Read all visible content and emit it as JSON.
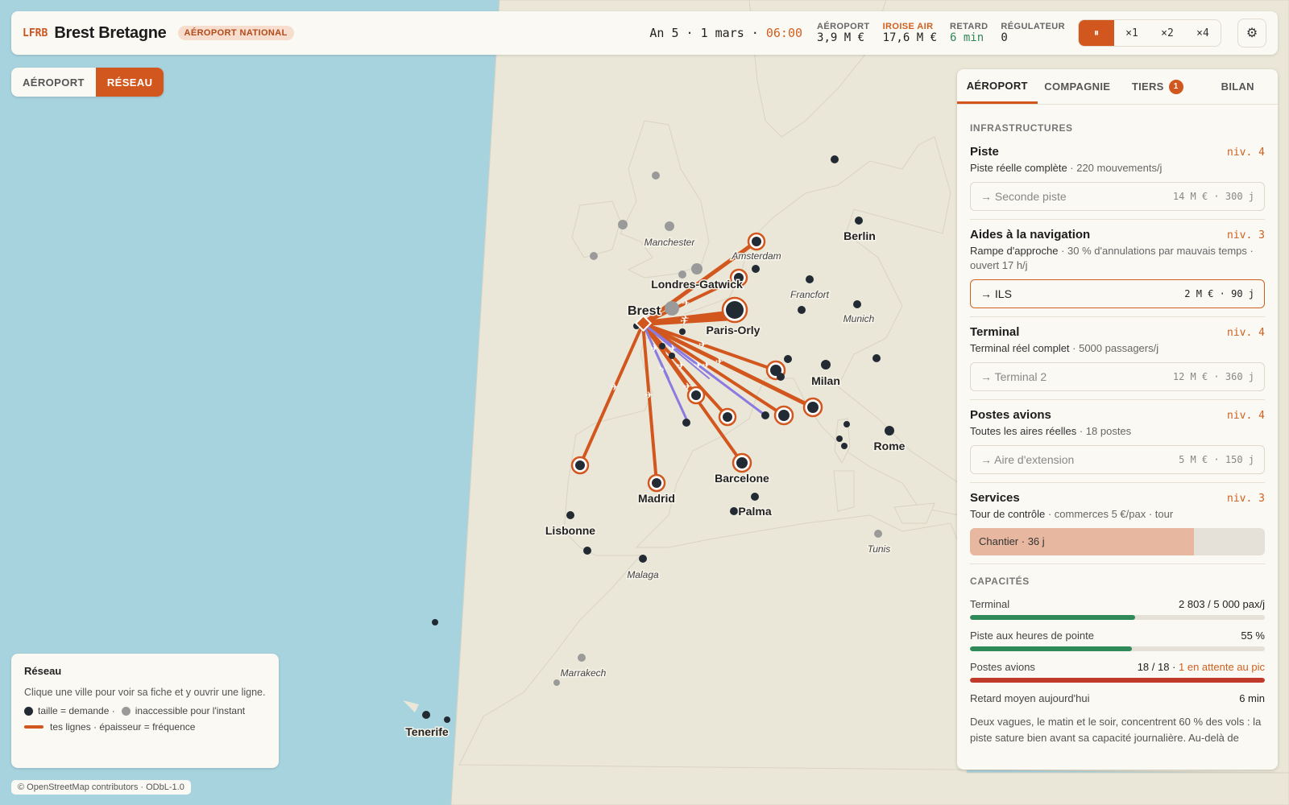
{
  "header": {
    "code": "LFRB",
    "airport_name": "Brest Bretagne",
    "category_badge": "AÉROPORT NATIONAL",
    "date_text": "An 5 · 1 mars · ",
    "time": "06:00",
    "stats": [
      {
        "label": "AÉROPORT",
        "value": "3,9 M €"
      },
      {
        "label": "IROISE AIR",
        "value": "17,6 M €"
      },
      {
        "label": "RETARD",
        "value": "6 min"
      },
      {
        "label": "RÉGULATEUR",
        "value": "0"
      }
    ],
    "speeds": [
      "⏸",
      "×1",
      "×2",
      "×4"
    ],
    "active_speed": 0,
    "settings_icon": "⚙"
  },
  "mode_tabs": {
    "items": [
      "AÉROPORT",
      "RÉSEAU"
    ],
    "active": 1
  },
  "panel": {
    "tabs": [
      {
        "label": "AÉROPORT"
      },
      {
        "label": "COMPAGNIE"
      },
      {
        "label": "TIERS",
        "count": "1"
      },
      {
        "label": "BILAN"
      }
    ],
    "active_tab": 0,
    "infra_title": "INFRASTRUCTURES",
    "items": [
      {
        "name": "Piste",
        "level": "niv. 4",
        "desc": "Piste réelle complète",
        "meta": " · 220 mouvements/j",
        "upgrade": "→ Seconde piste",
        "cost": "14 M € · 300 j",
        "affordable": false
      },
      {
        "name": "Aides à la navigation",
        "level": "niv. 3",
        "desc": "Rampe d'approche",
        "meta": " · 30 % d'annulations par mauvais temps · ouvert 17 h/j",
        "upgrade": "→ ILS",
        "cost": "2 M € · 90 j",
        "affordable": true
      },
      {
        "name": "Terminal",
        "level": "niv. 4",
        "desc": "Terminal réel complet",
        "meta": " · 5000 passagers/j",
        "upgrade": "→ Terminal 2",
        "cost": "12 M € · 360 j",
        "affordable": false
      },
      {
        "name": "Postes avions",
        "level": "niv. 4",
        "desc": "Toutes les aires réelles",
        "meta": " · 18 postes",
        "upgrade": "→ Aire d'extension",
        "cost": "5 M € · 150 j",
        "affordable": false
      }
    ],
    "services": {
      "name": "Services",
      "level": "niv. 3",
      "desc": "Tour de contrôle",
      "meta": " · commerces 5 €/pax · tour",
      "construction": "Chantier · 36 j",
      "construction_progress": 0.76
    },
    "cap_title": "CAPACITÉS",
    "capacities": [
      {
        "label": "Terminal",
        "value": "2 803 / 5 000 pax/j",
        "extra": "",
        "fraction": 0.56,
        "color": "#2f8a5a"
      },
      {
        "label": "Piste aux heures de pointe",
        "value": "55 %",
        "extra": "",
        "fraction": 0.55,
        "color": "#2f8a5a"
      },
      {
        "label": "Postes avions",
        "value": "18 / 18 · ",
        "extra": "1 en attente au pic",
        "fraction": 1.0,
        "color": "#c0392b"
      }
    ],
    "delay_label": "Retard moyen aujourd'hui",
    "delay_value": "6 min",
    "note": "Deux vagues, le matin et le soir, concentrent 60 % des vols : la piste sature bien avant sa capacité journalière. Au-delà de"
  },
  "legend": {
    "title": "Réseau",
    "text": "Clique une ville pour voir sa fiche et y ouvrir une ligne.",
    "size_label": "taille = demande ·",
    "inaccessible_label": "inaccessible pour l'instant",
    "lines_label": "tes lignes · épaisseur = fréquence"
  },
  "attribution": "© OpenStreetMap contributors · ODbL-1.0",
  "map": {
    "hub": "Brest",
    "labels": [
      {
        "text": "Amsterdam",
        "italic": true
      },
      {
        "text": "Berlin",
        "italic": false
      },
      {
        "text": "Manchester",
        "italic": true
      },
      {
        "text": "Londres-Gatwick",
        "italic": false
      },
      {
        "text": "Francfort",
        "italic": true
      },
      {
        "text": "Munich",
        "italic": true
      },
      {
        "text": "Paris-Orly",
        "italic": false
      },
      {
        "text": "Milan",
        "italic": false
      },
      {
        "text": "Rome",
        "italic": false
      },
      {
        "text": "Barcelone",
        "italic": false
      },
      {
        "text": "Madrid",
        "italic": false
      },
      {
        "text": "Palma",
        "italic": false
      },
      {
        "text": "Lisbonne",
        "italic": false
      },
      {
        "text": "Malaga",
        "italic": true
      },
      {
        "text": "Tunis",
        "italic": true
      },
      {
        "text": "Marrakech",
        "italic": true
      },
      {
        "text": "Tenerife",
        "italic": false
      }
    ],
    "colors": {
      "sea": "#a7d3df",
      "land": "#ebe7d8",
      "route": "#d2571e",
      "route_alt": "#8b7be0",
      "city": "#222a33",
      "inaccessible": "#9a9a9a"
    }
  }
}
